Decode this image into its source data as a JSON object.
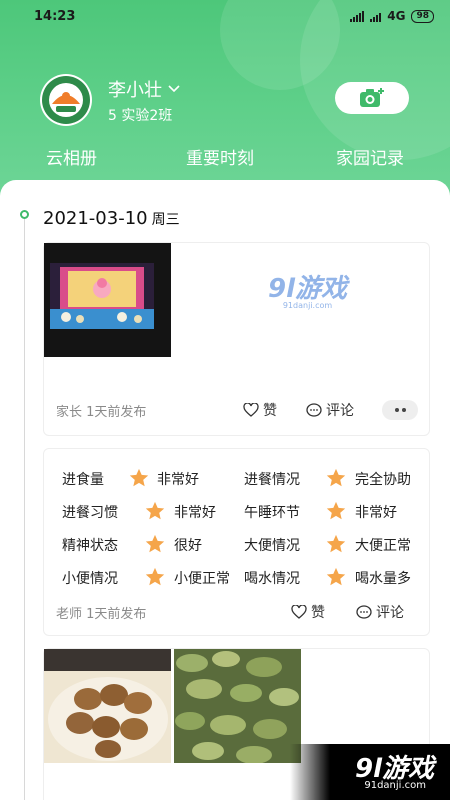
{
  "status_bar": {
    "time": "14:23",
    "network": "4G",
    "battery": "98"
  },
  "profile": {
    "name": "李小壮",
    "class": "5  实验2班"
  },
  "tabs": [
    {
      "label": "云相册"
    },
    {
      "label": "重要时刻"
    },
    {
      "label": "家园记录"
    }
  ],
  "timeline": {
    "date": "2021-03-10",
    "weekday": "周三",
    "post1": {
      "meta": "家长 1天前发布",
      "like_label": "赞",
      "comment_label": "评论"
    },
    "report": {
      "rows": [
        [
          {
            "label": "进食量",
            "value": "非常好"
          },
          {
            "label": "进餐情况",
            "value": "完全协助"
          }
        ],
        [
          {
            "label": "进餐习惯",
            "value": "非常好"
          },
          {
            "label": "午睡环节",
            "value": "非常好"
          }
        ],
        [
          {
            "label": "精神状态",
            "value": "很好"
          },
          {
            "label": "大便情况",
            "value": "大便正常"
          }
        ],
        [
          {
            "label": "小便情况",
            "value": "小便正常"
          },
          {
            "label": "喝水情况",
            "value": "喝水量多"
          }
        ]
      ],
      "meta": "老师 1天前发布",
      "like_label": "赞",
      "comment_label": "评论"
    }
  },
  "watermark": {
    "top_logo": "9l游戏",
    "top_url": "91danji.com",
    "bottom_logo": "9l游戏",
    "bottom_url": "91danji.com"
  },
  "colors": {
    "header_green": "#4dc77a",
    "accent_green": "#3fba6a",
    "star_orange": "#f5a54a"
  }
}
